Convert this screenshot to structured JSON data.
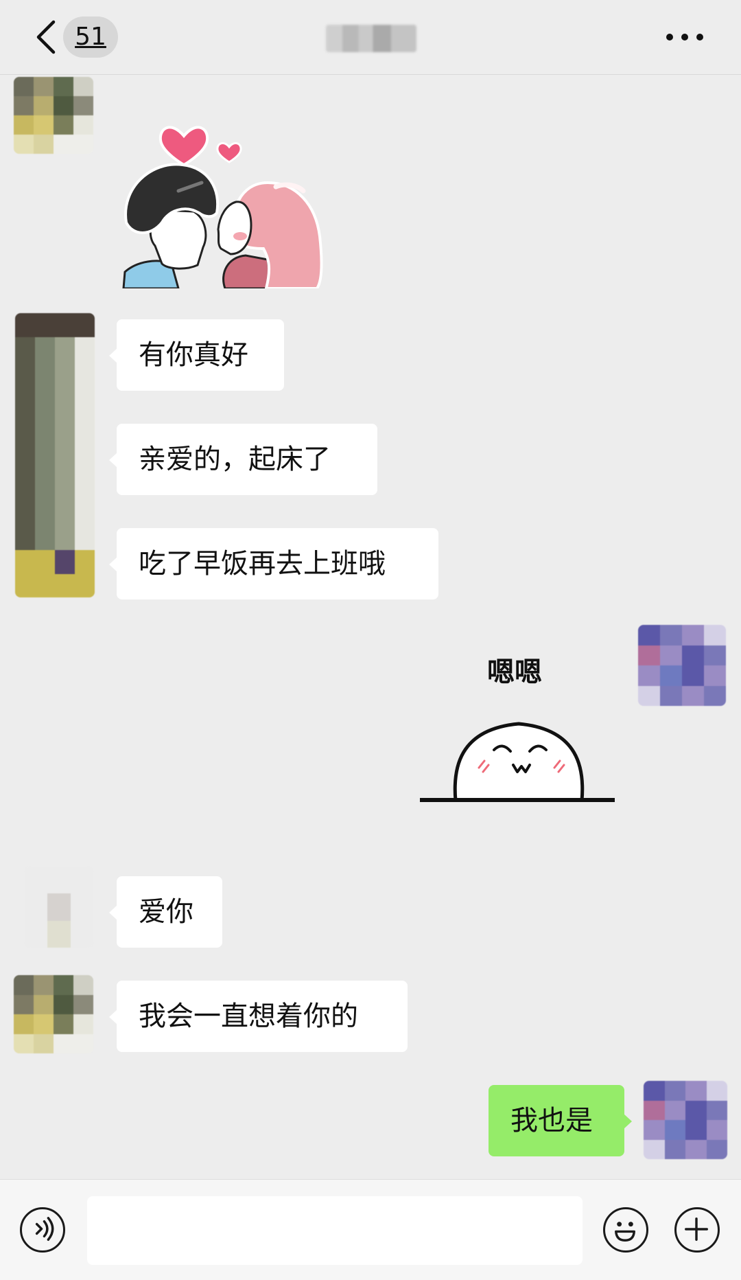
{
  "header": {
    "unread_count": "51",
    "back_icon": "chevron-left-icon",
    "more_icon": "ellipsis-icon"
  },
  "messages": [
    {
      "from": "them",
      "type": "sticker",
      "sticker": "kissing-couple-sticker"
    },
    {
      "from": "them",
      "type": "text",
      "text": "有你真好"
    },
    {
      "from": "them",
      "type": "text",
      "text": "亲爱的，起床了"
    },
    {
      "from": "them",
      "type": "text",
      "text": "吃了早饭再去上班哦"
    },
    {
      "from": "me",
      "type": "sticker",
      "sticker": "smiling-ball-sticker",
      "sticker_text": "嗯嗯"
    },
    {
      "from": "them",
      "type": "text",
      "text": "爱你"
    },
    {
      "from": "them",
      "type": "text",
      "text": "我会一直想着你的"
    },
    {
      "from": "me",
      "type": "text",
      "text": "我也是"
    }
  ],
  "input_bar": {
    "value": "",
    "voice_icon": "voice-icon",
    "emoji_icon": "emoji-icon",
    "plus_icon": "plus-icon"
  },
  "colors": {
    "background": "#ededed",
    "incoming_bubble": "#ffffff",
    "outgoing_bubble": "#95ec69"
  }
}
